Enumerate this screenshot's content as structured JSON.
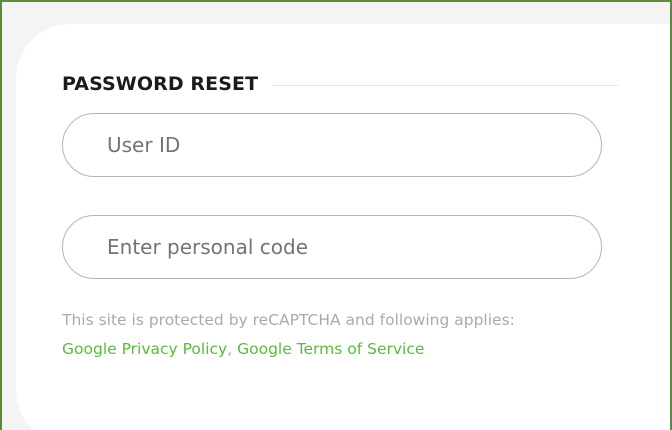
{
  "form": {
    "title": "PASSWORD RESET",
    "user_id": {
      "placeholder": "User ID",
      "value": ""
    },
    "personal_code": {
      "placeholder": "Enter personal code",
      "value": ""
    }
  },
  "recaptcha": {
    "notice": "This site is protected by reCAPTCHA and following applies:",
    "privacy_link": "Google Privacy Policy",
    "separator": ",",
    "terms_link": "Google Terms of Service"
  },
  "colors": {
    "frame_border": "#5c8a3c",
    "link": "#5cb940",
    "notice_text": "#a9aaa9",
    "title_text": "#1b1b1b",
    "input_border": "#b5b7b5"
  }
}
